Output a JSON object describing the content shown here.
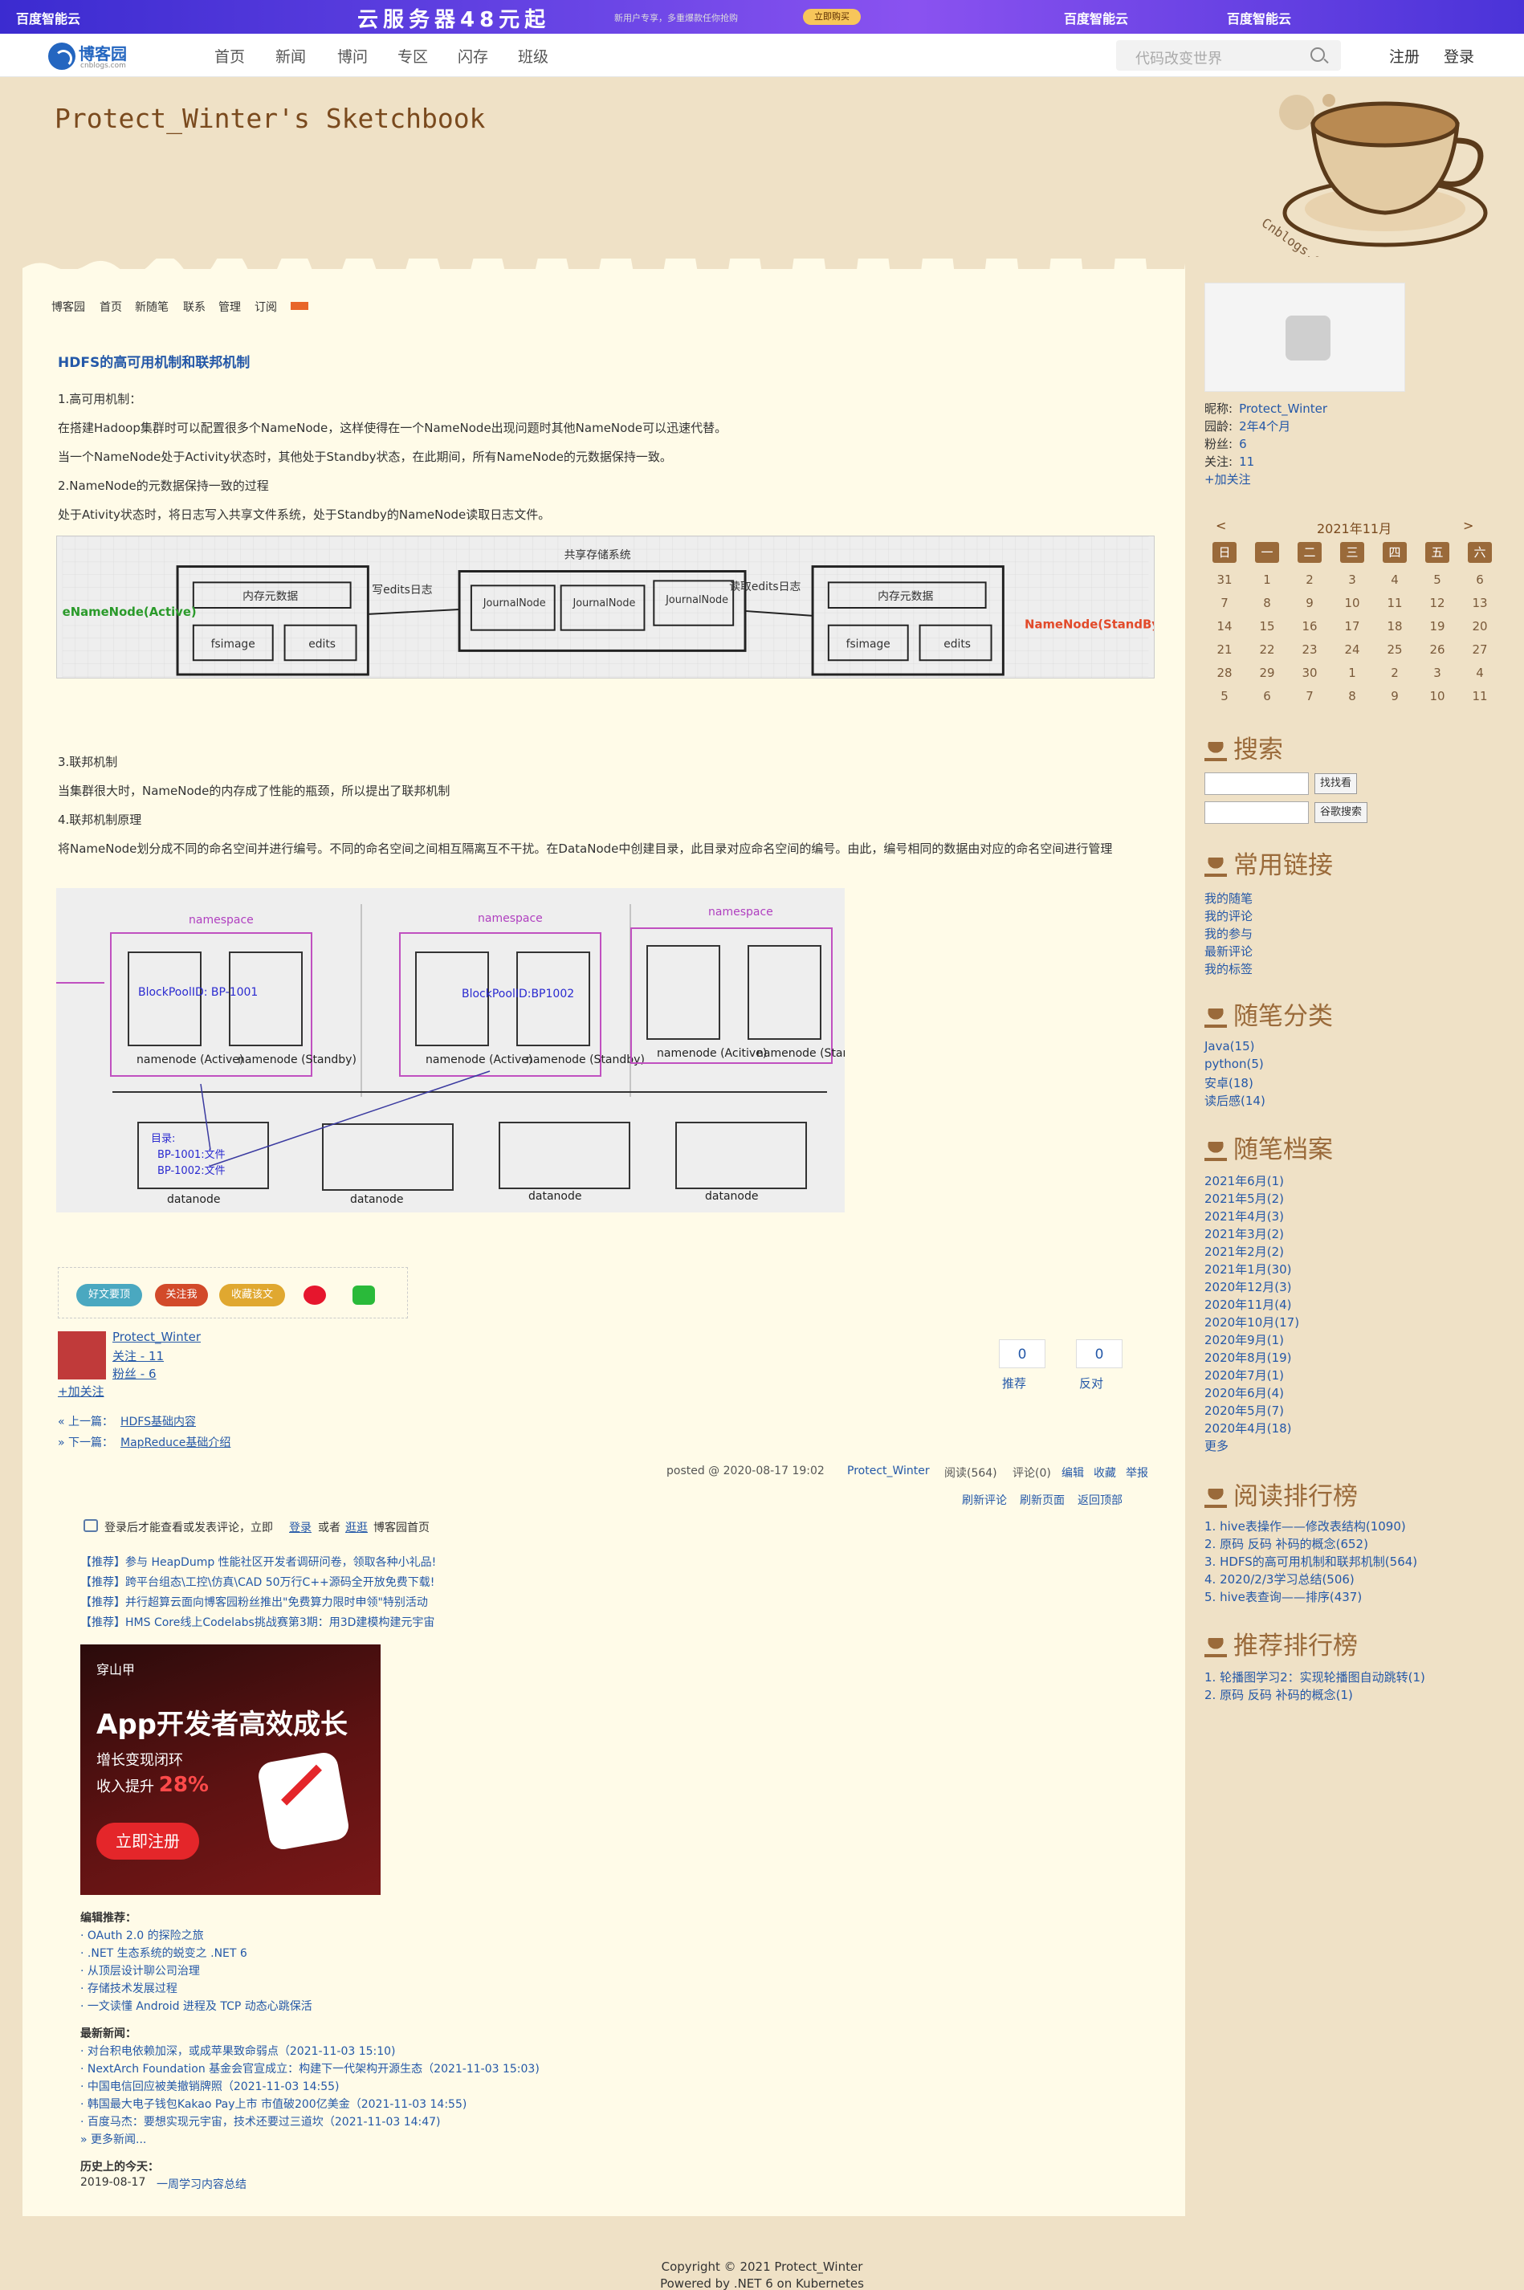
{
  "banner": {
    "brand": "百度智能云",
    "promo": "云服务器48元起",
    "sub": "新用户专享，多重爆款任你抢购",
    "buy": "立即购买"
  },
  "nav": {
    "logo_text": "博客园",
    "logo_sub": "cnblogs.com",
    "items": [
      "首页",
      "新闻",
      "博问",
      "专区",
      "闪存",
      "班级"
    ],
    "search_placeholder": "代码改变世界",
    "register": "注册",
    "login": "登录"
  },
  "blog": {
    "title": "Protect_Winter's Sketchbook",
    "watermark": "Cnblogs.com"
  },
  "subnav": [
    "博客园",
    "首页",
    "新随笔",
    "联系",
    "管理",
    "订阅"
  ],
  "post": {
    "title": "HDFS的高可用机制和联邦机制",
    "paras": [
      "1.高可用机制：",
      "在搭建Hadoop集群时可以配置很多个NameNode，这样使得在一个NameNode出现问题时其他NameNode可以迅速代替。",
      "当一个NameNode处于Activity状态时，其他处于Standby状态，在此期间，所有NameNode的元数据保持一致。",
      "2.NameNode的元数据保持一致的过程",
      "处于Ativity状态时，将日志写入共享文件系统，处于Standby的NameNode读取日志文件。",
      "3.联邦机制",
      "当集群很大时，NameNode的内存成了性能的瓶颈，所以提出了联邦机制",
      "4.联邦机制原理",
      "将NameNode划分成不同的命名空间并进行编号。不同的命名空间之间相互隔离互不干扰。在DataNode中创建目录，此目录对应命名空间的编号。由此，编号相同的数据由对应的命名空间进行管理"
    ],
    "fig1": {
      "shared": "共享存储系统",
      "active": "eNameNode(Active)",
      "standby": "NameNode(StandBy",
      "mem": "内存元数据",
      "fsimage": "fsimage",
      "edits": "edits",
      "write": "写edits日志",
      "read": "读取edits日志",
      "journal": "JournalNode"
    },
    "fig2": {
      "ns": "namespace",
      "bp1": "BlockPoolID: BP-1001",
      "bp2": "BlockPoolID:BP1002",
      "nn_a": "namenode (Active)",
      "nn_s": "namenode (Standby)",
      "nn_ac": "namenode (Acitive)",
      "dir": "目录:",
      "f1": "BP-1001:文件",
      "f2": "BP-1002:文件",
      "dn": "datanode"
    }
  },
  "share": {
    "good": "好文要顶",
    "follow": "关注我",
    "fav": "收藏该文"
  },
  "author": {
    "name": "Protect_Winter",
    "follow": "关注 - 11",
    "fans": "粉丝 - 6",
    "add": "+加关注"
  },
  "votes": {
    "up": "0",
    "up_label": "推荐",
    "down": "0",
    "down_label": "反对"
  },
  "prevnext": {
    "prev_label": "« 上一篇：",
    "prev": "HDFS基础内容",
    "next_label": "» 下一篇：",
    "next": "MapReduce基础介绍"
  },
  "postinfo": {
    "posted": "posted @ 2020-08-17 19:02",
    "author": "Protect_Winter",
    "reads": "阅读(564)",
    "comments": "评论(0)",
    "edit": "编辑",
    "fav": "收藏",
    "report": "举报",
    "refresh_c": "刷新评论",
    "refresh_p": "刷新页面",
    "top": "返回顶部"
  },
  "login_tip": {
    "pre": "登录后才能查看或发表评论，立即",
    "login": "登录",
    "or": "或者",
    "visit": "逛逛",
    "post": "博客园首页"
  },
  "recommend": [
    "【推荐】参与 HeapDump 性能社区开发者调研问卷，领取各种小礼品!",
    "【推荐】跨平台组态\\工控\\仿真\\CAD 50万行C++源码全开放免费下载!",
    "【推荐】并行超算云面向博客园粉丝推出\"免费算力限时申领\"特别活动",
    "【推荐】HMS Core线上Codelabs挑战赛第3期：用3D建模构建元宇宙"
  ],
  "ad": {
    "brand": "穿山甲",
    "headline": "App开发者高效成长",
    "l1": "增长变现闭环",
    "l2_pre": "收入提升",
    "l2_val": "28%",
    "cta": "立即注册"
  },
  "editor": {
    "title": "编辑推荐：",
    "items": [
      "· OAuth 2.0 的探险之旅",
      "· .NET 生态系统的蜕变之 .NET 6",
      "· 从顶层设计聊公司治理",
      "· 存储技术发展过程",
      "· 一文读懂 Android 进程及 TCP 动态心跳保活"
    ]
  },
  "news": {
    "title": "最新新闻：",
    "items": [
      "· 对台积电依赖加深，或成苹果致命弱点（2021-11-03 15:10)",
      "· NextArch Foundation 基金会官宣成立：构建下一代架构开源生态（2021-11-03 15:03)",
      "· 中国电信回应被美撤销牌照（2021-11-03 14:55)",
      "· 韩国最大电子钱包Kakao Pay上市 市值破200亿美金（2021-11-03 14:55)",
      "· 百度马杰：要想实现元宇宙，技术还要过三道坎（2021-11-03 14:47)"
    ],
    "more": "» 更多新闻..."
  },
  "history": {
    "title": "历史上的今天：",
    "date": "2019-08-17",
    "link": "一周学习内容总结"
  },
  "sidebar": {
    "nick_label": "昵称:",
    "nick": "Protect_Winter",
    "age_label": "园龄:",
    "age": "2年4个月",
    "fans_label": "粉丝:",
    "fans": "6",
    "follow_label": "关注:",
    "follow": "11",
    "add": "+加关注",
    "calendar": {
      "prev": "<",
      "title": "2021年11月",
      "next": ">",
      "dows": [
        "日",
        "一",
        "二",
        "三",
        "四",
        "五",
        "六"
      ],
      "weeks": [
        [
          "31",
          "1",
          "2",
          "3",
          "4",
          "5",
          "6"
        ],
        [
          "7",
          "8",
          "9",
          "10",
          "11",
          "12",
          "13"
        ],
        [
          "14",
          "15",
          "16",
          "17",
          "18",
          "19",
          "20"
        ],
        [
          "21",
          "22",
          "23",
          "24",
          "25",
          "26",
          "27"
        ],
        [
          "28",
          "29",
          "30",
          "1",
          "2",
          "3",
          "4"
        ],
        [
          "5",
          "6",
          "7",
          "8",
          "9",
          "10",
          "11"
        ]
      ]
    },
    "search_title": "搜索",
    "search_btn": "找找看",
    "google_btn": "谷歌搜索",
    "links_title": "常用链接",
    "links": [
      "我的随笔",
      "我的评论",
      "我的参与",
      "最新评论",
      "我的标签"
    ],
    "cat_title": "随笔分类",
    "cats": [
      "Java(15)",
      "python(5)",
      "安卓(18)",
      "读后感(14)"
    ],
    "arch_title": "随笔档案",
    "archives": [
      "2021年6月(1)",
      "2021年5月(2)",
      "2021年4月(3)",
      "2021年3月(2)",
      "2021年2月(2)",
      "2021年1月(30)",
      "2020年12月(3)",
      "2020年11月(4)",
      "2020年10月(17)",
      "2020年9月(1)",
      "2020年8月(19)",
      "2020年7月(1)",
      "2020年6月(4)",
      "2020年5月(7)",
      "2020年4月(18)",
      "更多"
    ],
    "read_title": "阅读排行榜",
    "reads": [
      "1. hive表操作——修改表结构(1090)",
      "2. 原码 反码 补码的概念(652)",
      "3. HDFS的高可用机制和联邦机制(564)",
      "4. 2020/2/3学习总结(506)",
      "5. hive表查询——排序(437)"
    ],
    "rec_title": "推荐排行榜",
    "recs": [
      "1. 轮播图学习2：实现轮播图自动跳转(1)",
      "2. 原码 反码 补码的概念(1)"
    ]
  },
  "footer": {
    "copy": "Copyright © 2021 Protect_Winter",
    "powered": "Powered by .NET 6 on Kubernetes"
  }
}
